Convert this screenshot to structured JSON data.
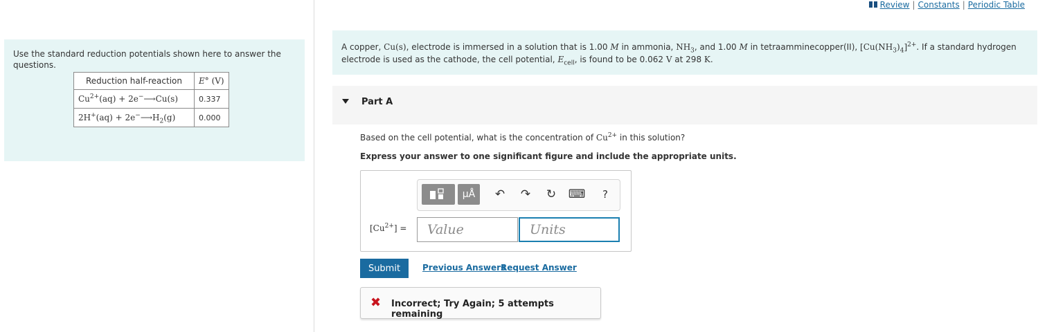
{
  "top_links": {
    "review": "Review",
    "constants": "Constants",
    "periodic_table": "Periodic Table",
    "separator": "|"
  },
  "left_panel": {
    "intro": "Use the standard reduction potentials shown here to answer the questions.",
    "table": {
      "header_reaction": "Reduction half-reaction",
      "header_potential_symbol": "E°",
      "header_potential_unit": "(V)",
      "rows": [
        {
          "reactant": "Cu",
          "reactant_charge": "2+",
          "phase_left": "(aq) + 2e",
          "electron_charge": "−",
          "arrow": "⟶",
          "product": "Cu(s)",
          "value": "0.337"
        },
        {
          "reactant": "2H",
          "reactant_charge": "+",
          "phase_left": "(aq) + 2e",
          "electron_charge": "−",
          "arrow": "⟶",
          "product": "H",
          "product_sub": "2",
          "product_phase": "(g)",
          "value": "0.000"
        }
      ]
    }
  },
  "problem": {
    "p1": "A copper, ",
    "cu_s": "Cu(s)",
    "p2": ", electrode is immersed in a solution that is 1.00 ",
    "m1": "M",
    "p3": " in ammonia, ",
    "nh3_a": "NH",
    "nh3_sub": "3",
    "p4": ", and 1.00 ",
    "m2": "M",
    "p5": " in tetraamminecopper(II), ",
    "complex_a": "[Cu(NH",
    "complex_sub1": "3",
    "complex_b": ")",
    "complex_sub2": "4",
    "complex_c": "]",
    "complex_charge": "2+",
    "p6": ". If a standard hydrogen electrode is used as the cathode, the cell potential, ",
    "ecell_e": "E",
    "ecell_sub": "cell",
    "p7": ", is found to be 0.062 ",
    "volt": "V",
    "p8": " at 298 ",
    "kelvin": "K",
    "p9": "."
  },
  "part": {
    "title": "Part A",
    "question_a": "Based on the cell potential, what is the concentration of ",
    "question_cu": "Cu",
    "question_charge": "2+",
    "question_b": " in this solution?",
    "instruction": "Express your answer to one significant figure and include the appropriate units."
  },
  "toolbar": {
    "units_label": "μÅ",
    "undo_icon": "↶",
    "redo_icon": "↷",
    "reset_icon": "↻",
    "keyboard_icon": "⌨",
    "help_label": "?"
  },
  "answer": {
    "label_open": "[Cu",
    "label_charge": "2+",
    "label_close": "] =",
    "value_placeholder": "Value",
    "units_placeholder": "Units"
  },
  "actions": {
    "submit": "Submit",
    "previous_answers": "Previous Answers",
    "request_answer": "Request Answer"
  },
  "feedback": {
    "icon": "✖",
    "text": "Incorrect; Try Again; 5 attempts remaining"
  },
  "colors": {
    "accent": "#1a6ba0",
    "panel_bg": "#e6f5f5",
    "error": "#c8141e",
    "active_input_border": "#1a7fb0"
  }
}
